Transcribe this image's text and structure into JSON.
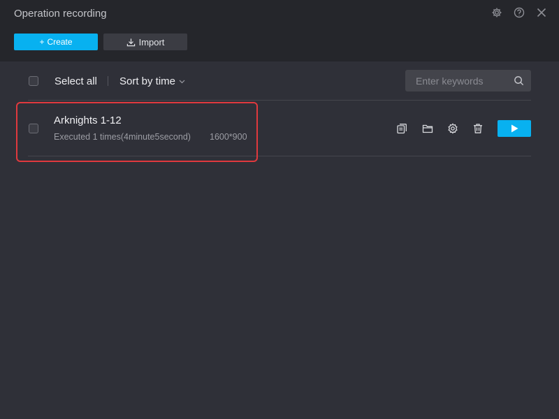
{
  "window": {
    "title": "Operation recording",
    "icons": [
      "gear-icon",
      "help-icon",
      "close-icon"
    ]
  },
  "actions": {
    "create_label": "Create",
    "import_label": "Import"
  },
  "toolbar": {
    "select_all_label": "Select all",
    "sort_label": "Sort by time",
    "search_placeholder": "Enter keywords",
    "search_value": ""
  },
  "recordings": [
    {
      "name": "Arknights 1-12",
      "executed": "Executed 1 times(4minute5second)",
      "resolution": "1600*900",
      "checked": false,
      "highlighted": true,
      "icons": [
        "copy-icon",
        "folder-icon",
        "settings-icon",
        "delete-icon",
        "play-icon"
      ]
    }
  ],
  "colors": {
    "accent": "#08b1f0",
    "background": "#2f3038",
    "header": "#25262b",
    "highlight": "#e0393e"
  }
}
